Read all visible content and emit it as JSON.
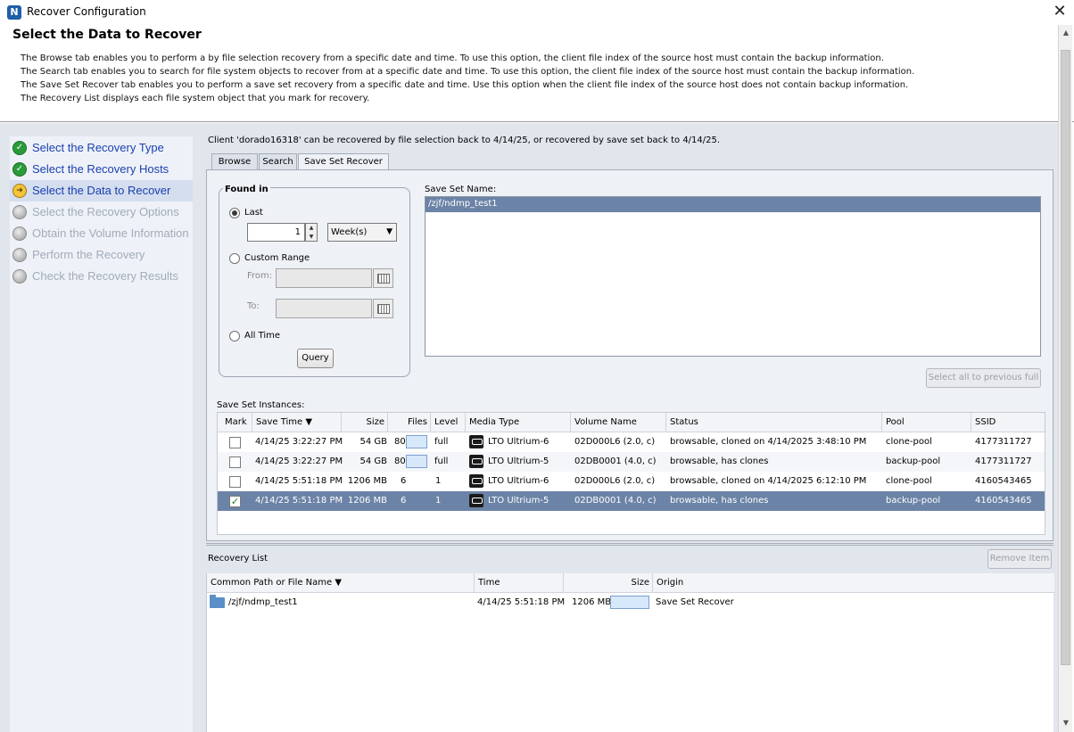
{
  "window": {
    "app_icon_letter": "N",
    "title": "Recover Configuration",
    "close_glyph": "✕"
  },
  "header": {
    "title": "Select the Data to Recover",
    "descriptions": [
      "The Browse tab enables you to perform a by file selection recovery from a specific date and time. To use this option, the client file index of the source host must contain the backup information.",
      "The Search tab enables you to search for file system objects to recover from at a specific date and time. To use this option, the client file index of the source host must contain the backup information.",
      "The Save Set Recover tab enables you to perform a save set recovery from a specific date and time.  Use this option when the client file index of the source host does not contain backup information.",
      "The Recovery List displays each file system object that you mark for recovery."
    ]
  },
  "wizard": {
    "steps": [
      {
        "label": "Select the Recovery Type",
        "state": "done",
        "icon": "check-circle-icon"
      },
      {
        "label": "Select the Recovery Hosts",
        "state": "done",
        "icon": "check-circle-icon"
      },
      {
        "label": "Select the Data to Recover",
        "state": "current",
        "icon": "current-step-icon"
      },
      {
        "label": "Select the Recovery Options",
        "state": "pending",
        "icon": "pending-step-icon"
      },
      {
        "label": "Obtain the Volume Information",
        "state": "pending",
        "icon": "pending-step-icon"
      },
      {
        "label": "Perform the Recovery",
        "state": "pending",
        "icon": "pending-step-icon"
      },
      {
        "label": "Check the Recovery Results",
        "state": "pending",
        "icon": "pending-step-icon"
      }
    ]
  },
  "content": {
    "client_message": "Client 'dorado16318' can be recovered by file selection back to 4/14/25, or recovered by save set back to 4/14/25.",
    "tabs": [
      "Browse",
      "Search",
      "Save Set Recover"
    ],
    "active_tab": "Save Set Recover"
  },
  "found_in": {
    "title": "Found in",
    "last_label": "Last",
    "last_value": "1",
    "unit": "Week(s)",
    "custom_range_label": "Custom Range",
    "from_label": "From:",
    "to_label": "To:",
    "all_time_label": "All Time",
    "selected_option": "Last",
    "query_label": "Query"
  },
  "save_set_name": {
    "label": "Save Set Name:",
    "items": [
      "/zjf/ndmp_test1"
    ],
    "select_all_label": "Select all to previous full"
  },
  "instances": {
    "label": "Save Set Instances:",
    "columns": [
      "Mark",
      "Save Time",
      "Size",
      "Files",
      "Level",
      "Media Type",
      "Volume Name",
      "Status",
      "Pool",
      "SSID"
    ],
    "rows": [
      {
        "mark": false,
        "save_time": "4/14/25 3:22:27 PM",
        "size": "54 GB",
        "files": "80",
        "level": "full",
        "media_type": "LTO Ultrium-6",
        "volume": "02D000L6 (2.0, c)",
        "status": "browsable,  cloned on 4/14/2025 3:48:10 PM",
        "pool": "clone-pool",
        "ssid": "4177311727",
        "selected": false
      },
      {
        "mark": false,
        "save_time": "4/14/25 3:22:27 PM",
        "size": "54 GB",
        "files": "80",
        "level": "full",
        "media_type": "LTO Ultrium-5",
        "volume": "02DB0001 (4.0, c)",
        "status": "browsable,  has clones",
        "pool": "backup-pool",
        "ssid": "4177311727",
        "selected": false
      },
      {
        "mark": false,
        "save_time": "4/14/25 5:51:18 PM",
        "size": "1206 MB",
        "files": "6",
        "level": "1",
        "media_type": "LTO Ultrium-6",
        "volume": "02D000L6 (2.0, c)",
        "status": "browsable,  cloned on 4/14/2025 6:12:10 PM",
        "pool": "clone-pool",
        "ssid": "4160543465",
        "selected": false
      },
      {
        "mark": true,
        "save_time": "4/14/25 5:51:18 PM",
        "size": "1206 MB",
        "files": "6",
        "level": "1",
        "media_type": "LTO Ultrium-5",
        "volume": "02DB0001 (4.0, c)",
        "status": "browsable,  has clones",
        "pool": "backup-pool",
        "ssid": "4160543465",
        "selected": true
      }
    ]
  },
  "recovery_list": {
    "label": "Recovery List",
    "remove_label": "Remove Item",
    "columns": [
      "Common Path or File Name",
      "Time",
      "Size",
      "Origin"
    ],
    "rows": [
      {
        "path": "/zjf/ndmp_test1",
        "time": "4/14/25 5:51:18 PM",
        "size": "1206 MB",
        "origin": "Save Set Recover"
      }
    ]
  }
}
